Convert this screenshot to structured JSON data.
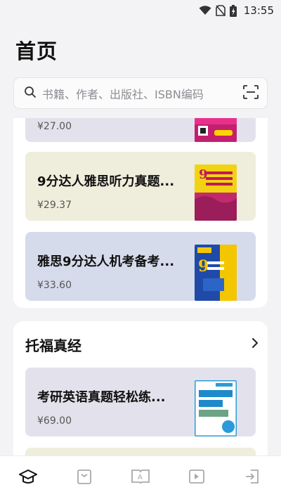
{
  "status": {
    "time": "13:55"
  },
  "header": {
    "title": "首页"
  },
  "search": {
    "placeholder": "书籍、作者、出版社、ISBN编码"
  },
  "top_section": {
    "books": [
      {
        "title": "",
        "price": "¥27.00",
        "color": "#e3e2ec"
      },
      {
        "title": "9分达人雅思听力真题...",
        "price": "¥29.37",
        "color": "#efeddc"
      },
      {
        "title": "雅思9分达人机考备考...",
        "price": "¥33.60",
        "color": "#d6dbec"
      }
    ]
  },
  "toefl_section": {
    "title": "托福真经",
    "books": [
      {
        "title": "考研英语真题轻松练...",
        "price": "¥69.00",
        "color": "#e3e2ec"
      },
      {
        "title": "",
        "price": "",
        "color": "#efeddc"
      }
    ]
  },
  "nav": [
    {
      "name": "home",
      "icon": "graduation-cap-icon",
      "active": true
    },
    {
      "name": "bookshelf",
      "icon": "box-icon",
      "active": false
    },
    {
      "name": "reader",
      "icon": "book-open-icon",
      "active": false
    },
    {
      "name": "video",
      "icon": "video-icon",
      "active": false
    },
    {
      "name": "profile",
      "icon": "exit-icon",
      "active": false
    }
  ],
  "colors": {
    "accent": "#111111",
    "muted_icon": "#a9a9ae"
  }
}
